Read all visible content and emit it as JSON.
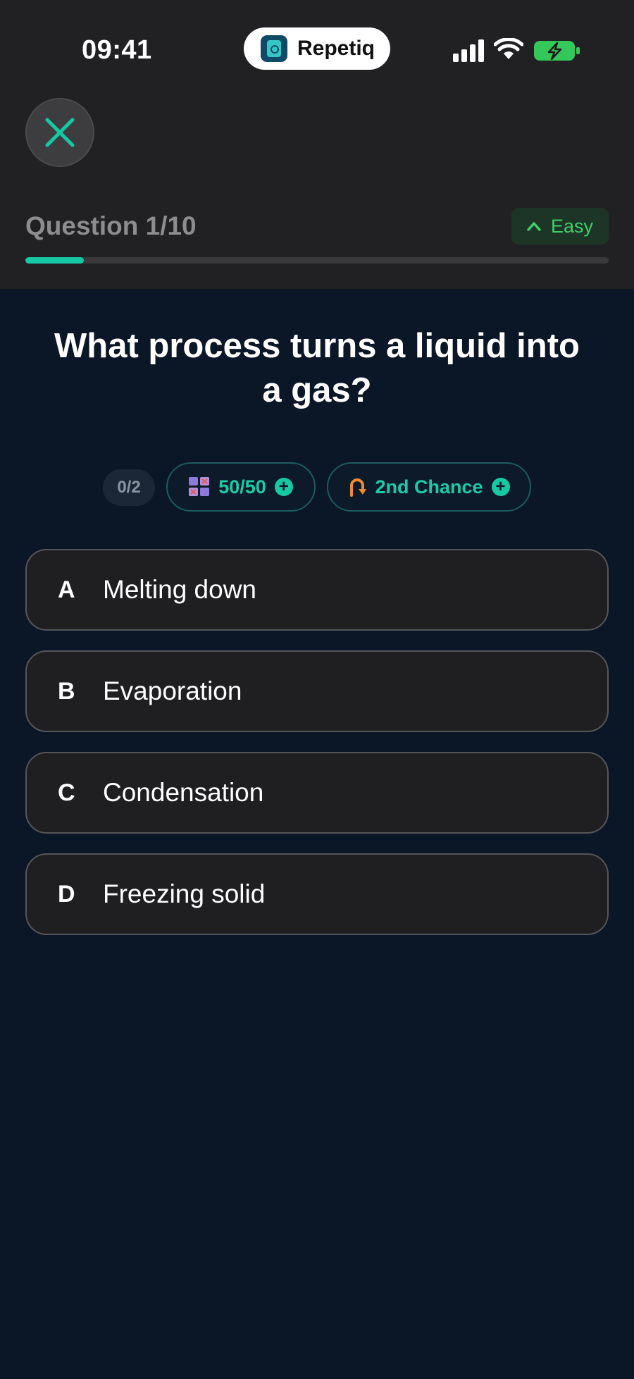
{
  "status_bar": {
    "time": "09:41",
    "app_name": "Repetiq"
  },
  "quiz": {
    "question_counter": "Question 1/10",
    "progress": 0.1,
    "difficulty": "Easy",
    "question": "What process turns a liquid into a gas?"
  },
  "lifelines": {
    "used_counter": "0/2",
    "fifty_fifty": "50/50",
    "second_chance": "2nd Chance"
  },
  "answers": [
    {
      "letter": "A",
      "text": "Melting down"
    },
    {
      "letter": "B",
      "text": "Evaporation"
    },
    {
      "letter": "C",
      "text": "Condensation"
    },
    {
      "letter": "D",
      "text": "Freezing solid"
    }
  ],
  "colors": {
    "accent": "#17c8a4",
    "easy_green": "#3fcf6a",
    "background": "#0b1627",
    "header_bg": "#212124"
  }
}
